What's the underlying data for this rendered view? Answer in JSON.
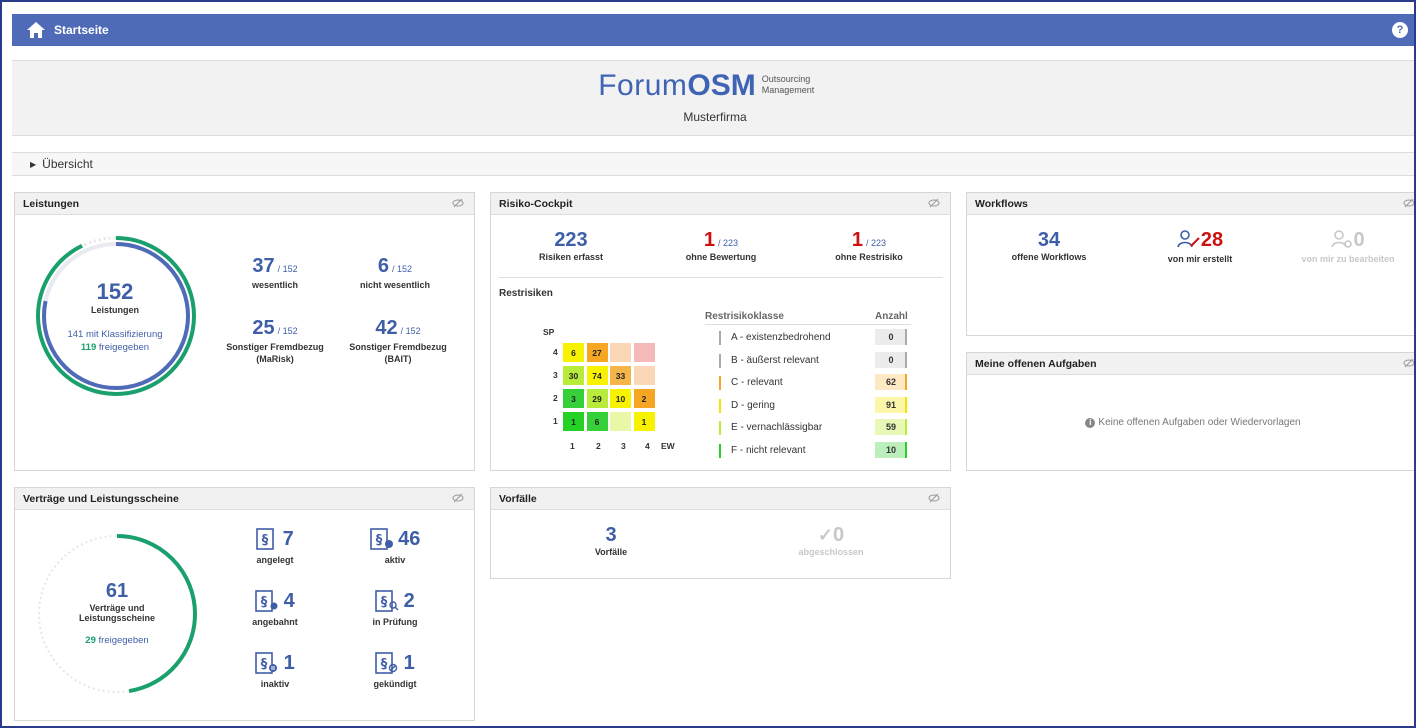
{
  "topbar": {
    "title": "Startseite",
    "help": "?"
  },
  "brand": {
    "forum": "Forum",
    "osm": "OSM",
    "sub1": "Outsourcing",
    "sub2": "Management",
    "company": "Musterfirma"
  },
  "overview": {
    "label": "Übersicht"
  },
  "leistungen": {
    "title": "Leistungen",
    "total": "152",
    "total_label": "Leistungen",
    "classified": "141 mit Klassifizierung",
    "released_num": "119",
    "released_text": " freigegeben",
    "stats": [
      {
        "value": "37",
        "of": "/ 152",
        "label": "wesentlich"
      },
      {
        "value": "6",
        "of": "/ 152",
        "label": "nicht wesentlich"
      },
      {
        "value": "25",
        "of": "/ 152",
        "label": "Sonstiger Fremdbezug",
        "label2": "(MaRisk)"
      },
      {
        "value": "42",
        "of": "/ 152",
        "label": "Sonstiger Fremdbezug",
        "label2": "(BAIT)"
      }
    ]
  },
  "risiko": {
    "title": "Risiko-Cockpit",
    "stats": [
      {
        "value": "223",
        "of": "",
        "label": "Risiken erfasst"
      },
      {
        "value": "1",
        "of": "/ 223",
        "label": "ohne Bewertung"
      },
      {
        "value": "1",
        "of": "/ 223",
        "label": "ohne Restrisiko"
      }
    ],
    "section": "Restrisiken",
    "matrix_y_label": "SP",
    "matrix_x_label": "EW",
    "rows": [
      "4",
      "3",
      "2",
      "1"
    ],
    "cols": [
      "1",
      "2",
      "3",
      "4"
    ],
    "cells": [
      [
        "6",
        "27",
        "",
        ""
      ],
      [
        "30",
        "74",
        "33",
        ""
      ],
      [
        "3",
        "29",
        "10",
        "2"
      ],
      [
        "1",
        "6",
        "",
        "1"
      ]
    ],
    "cell_colors": [
      [
        "#f7f200",
        "#f5a623",
        "#fbd7b8",
        "#f6b9b9"
      ],
      [
        "#b9ec3a",
        "#f7f200",
        "#f5b54a",
        "#fbd7b8"
      ],
      [
        "#36d13a",
        "#b9ec3a",
        "#f7f200",
        "#f5a623"
      ],
      [
        "#25d125",
        "#36d13a",
        "#e9f7a8",
        "#f7f200"
      ]
    ],
    "class_header": "Restrisikoklasse",
    "count_header": "Anzahl",
    "classes": [
      {
        "label": "A - existenzbedrohend",
        "count": "0",
        "color": "#aaaaaa",
        "bg": "#ececec"
      },
      {
        "label": "B - äußerst relevant",
        "count": "0",
        "color": "#aaaaaa",
        "bg": "#ececec"
      },
      {
        "label": "C - relevant",
        "count": "62",
        "color": "#f5a623",
        "bg": "#fde9c4"
      },
      {
        "label": "D - gering",
        "count": "91",
        "color": "#f2e400",
        "bg": "#fbf6a9"
      },
      {
        "label": "E - vernachlässigbar",
        "count": "59",
        "color": "#b9ec3a",
        "bg": "#e7f8b7"
      },
      {
        "label": "F - nicht relevant",
        "count": "10",
        "color": "#25d125",
        "bg": "#bcefbc"
      }
    ]
  },
  "workflows": {
    "title": "Workflows",
    "stats": [
      {
        "value": "34",
        "label": "offene Workflows"
      },
      {
        "value": "28",
        "label": "von mir erstellt"
      },
      {
        "value": "0",
        "label": "von mir zu bearbeiten"
      }
    ]
  },
  "aufgaben": {
    "title": "Meine offenen Aufgaben",
    "empty": "Keine offenen Aufgaben oder Wiedervorlagen"
  },
  "vertraege": {
    "title": "Verträge und Leistungsscheine",
    "total": "61",
    "total_label1": "Verträge und",
    "total_label2": "Leistungsscheine",
    "released_num": "29",
    "released_text": " freigegeben",
    "stats": [
      {
        "value": "7",
        "label": "angelegt"
      },
      {
        "value": "46",
        "label": "aktiv"
      },
      {
        "value": "4",
        "label": "angebahnt"
      },
      {
        "value": "2",
        "label": "in Prüfung"
      },
      {
        "value": "1",
        "label": "inaktiv"
      },
      {
        "value": "1",
        "label": "gekündigt"
      }
    ]
  },
  "vorfaelle": {
    "title": "Vorfälle",
    "stats": [
      {
        "value": "3",
        "label": "Vorfälle"
      },
      {
        "value": "0",
        "label": "abgeschlossen"
      }
    ]
  },
  "progress": {
    "leistungen_classified": 0.928,
    "leistungen_released": 0.783,
    "vertraege_released": 0.475
  },
  "colors": {
    "accent": "#3f5ea8",
    "topbar": "#4f6bb8",
    "green": "#1aa06d",
    "red": "#cc1111"
  }
}
